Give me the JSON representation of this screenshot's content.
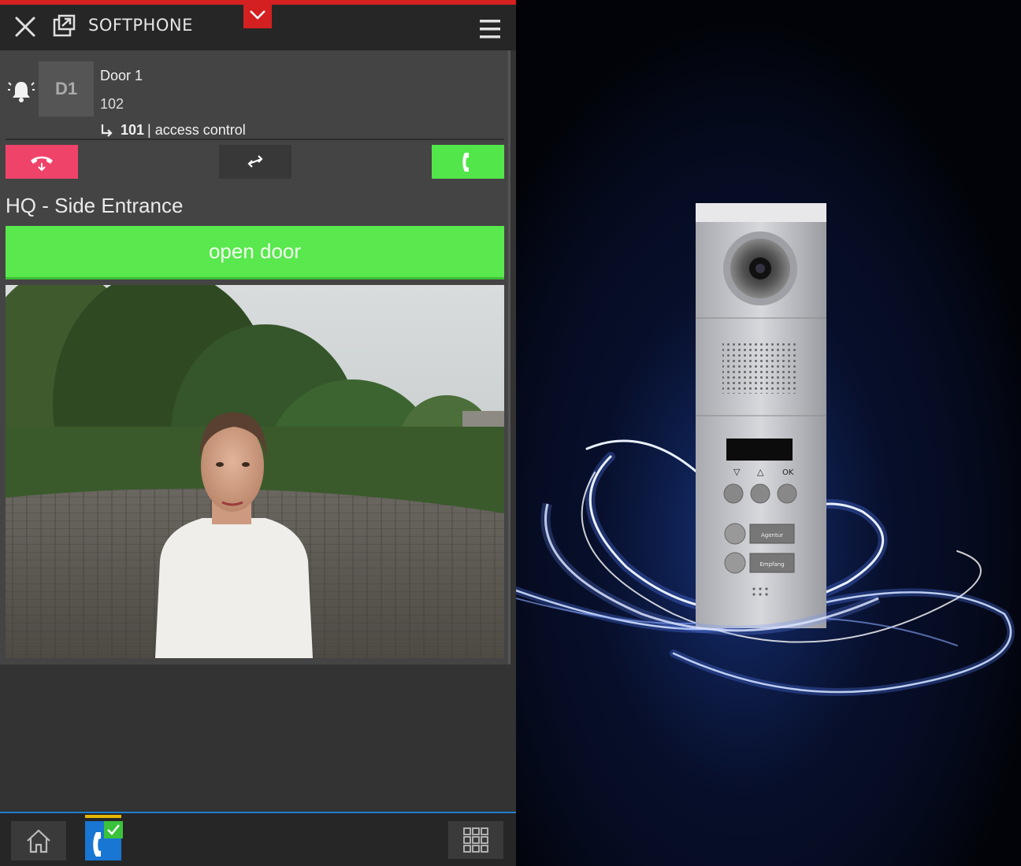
{
  "app": {
    "title": "SOFTPHONE"
  },
  "call": {
    "avatar_initials": "D1",
    "caller_name": "Door 1",
    "caller_number": "102",
    "forward_number": "101",
    "forward_label": "| access control"
  },
  "door": {
    "location_label": "HQ - Side Entrance",
    "open_button_label": "open door"
  },
  "intercom_panel": {
    "nav_down_label": "▽",
    "nav_up_label": "△",
    "ok_label": "OK",
    "button1_label": "Agentur",
    "button2_label": "Empfang"
  },
  "icons": {
    "close": "close-icon",
    "popout": "popout-icon",
    "collapse": "chevron-down-icon",
    "menu": "hamburger-menu-icon",
    "bell": "alarm-bell-icon",
    "hangup": "hangup-icon",
    "transfer": "transfer-icon",
    "answer": "answer-phone-icon",
    "home": "home-icon",
    "phone_tab": "phone-tab-icon",
    "keypad": "keypad-icon"
  },
  "colors": {
    "accent_red": "#d42020",
    "hangup": "#f0436a",
    "answer": "#52e64a",
    "open_door": "#59e84d",
    "tab_blue": "#1976d2",
    "tab_active": "#e8b800"
  }
}
